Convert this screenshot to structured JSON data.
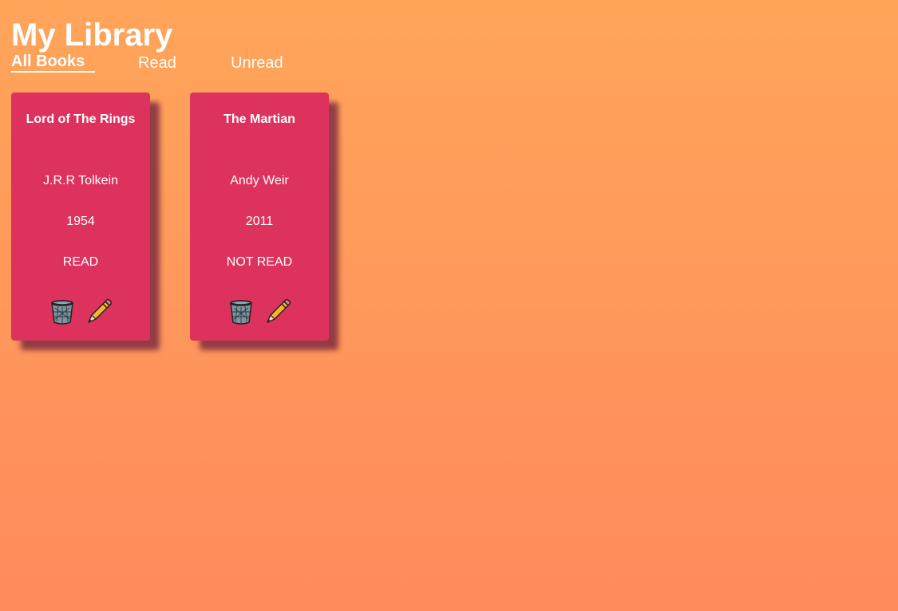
{
  "app": {
    "title": "My Library"
  },
  "tabs": [
    {
      "label": "All Books",
      "active": true
    },
    {
      "label": "Read",
      "active": false
    },
    {
      "label": "Unread",
      "active": false
    }
  ],
  "books": [
    {
      "title": "Lord of The Rings",
      "author": "J.R.R Tolkein",
      "year": "1954",
      "status": "READ",
      "actions": {
        "delete_icon": "trash-icon",
        "edit_icon": "pencil-icon"
      }
    },
    {
      "title": "The Martian",
      "author": "Andy Weir",
      "year": "2011",
      "status": "NOT READ",
      "actions": {
        "delete_icon": "trash-icon",
        "edit_icon": "pencil-icon"
      }
    }
  ],
  "colors": {
    "background_top": "#FFA55A",
    "background_bottom": "#FF8A5C",
    "card": "#DC325D",
    "text": "#FFFFFF"
  }
}
